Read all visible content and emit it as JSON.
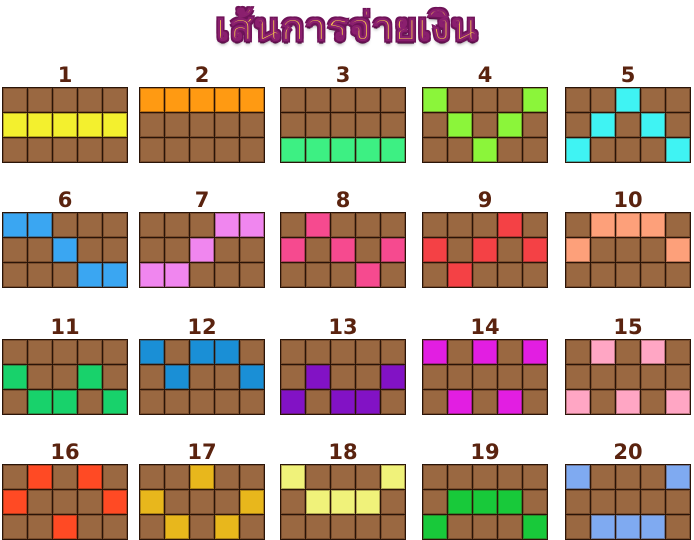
{
  "title": "เส้นการจ่ายเงิน",
  "base_cell_color": "#9a6841",
  "paylines": [
    {
      "number": "1",
      "color": "#f3f02e",
      "rows": [
        1,
        1,
        1,
        1,
        1
      ]
    },
    {
      "number": "2",
      "color": "#ff9a12",
      "rows": [
        0,
        0,
        0,
        0,
        0
      ]
    },
    {
      "number": "3",
      "color": "#3df083",
      "rows": [
        2,
        2,
        2,
        2,
        2
      ]
    },
    {
      "number": "4",
      "color": "#8bf53a",
      "rows": [
        0,
        1,
        2,
        1,
        0
      ]
    },
    {
      "number": "5",
      "color": "#3ff3f3",
      "rows": [
        2,
        1,
        0,
        1,
        2
      ]
    },
    {
      "number": "6",
      "color": "#3aa6f2",
      "rows": [
        0,
        0,
        1,
        2,
        2
      ]
    },
    {
      "number": "7",
      "color": "#f086ef",
      "rows": [
        2,
        2,
        1,
        0,
        0
      ]
    },
    {
      "number": "8",
      "color": "#f64a8f",
      "rows": [
        1,
        0,
        1,
        2,
        1
      ]
    },
    {
      "number": "9",
      "color": "#f44145",
      "rows": [
        1,
        2,
        1,
        0,
        1
      ]
    },
    {
      "number": "10",
      "color": "#fda07a",
      "rows": [
        1,
        0,
        0,
        0,
        1
      ]
    },
    {
      "number": "11",
      "color": "#18d26b",
      "rows": [
        1,
        2,
        2,
        1,
        2
      ]
    },
    {
      "number": "12",
      "color": "#1a8fd6",
      "rows": [
        0,
        1,
        0,
        0,
        1
      ]
    },
    {
      "number": "13",
      "color": "#8212c5",
      "rows": [
        2,
        1,
        2,
        2,
        1
      ]
    },
    {
      "number": "14",
      "color": "#e21ee2",
      "rows": [
        0,
        2,
        0,
        2,
        0
      ]
    },
    {
      "number": "15",
      "color": "#ffa6c4",
      "rows": [
        2,
        0,
        2,
        0,
        2
      ]
    },
    {
      "number": "16",
      "color": "#ff4a24",
      "rows": [
        1,
        0,
        2,
        0,
        1
      ]
    },
    {
      "number": "17",
      "color": "#e8b71c",
      "rows": [
        1,
        2,
        0,
        2,
        1
      ]
    },
    {
      "number": "18",
      "color": "#f0f27a",
      "rows": [
        0,
        1,
        1,
        1,
        0
      ]
    },
    {
      "number": "19",
      "color": "#18c93a",
      "rows": [
        2,
        1,
        1,
        1,
        2
      ]
    },
    {
      "number": "20",
      "color": "#7faaf1",
      "rows": [
        0,
        2,
        2,
        2,
        0
      ]
    }
  ]
}
